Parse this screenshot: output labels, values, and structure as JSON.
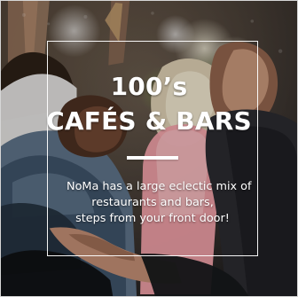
{
  "promo": {
    "headline_top": "100’s",
    "headline_main": "CAFÉS & BARS",
    "body_lines": [
      "NoMa has a large eclectic mix of",
      "restaurants and bars,",
      "steps from your front door!"
    ]
  },
  "colors": {
    "text": "#ffffff",
    "frame": "#ffffff",
    "photo_base": "#1a1714"
  }
}
